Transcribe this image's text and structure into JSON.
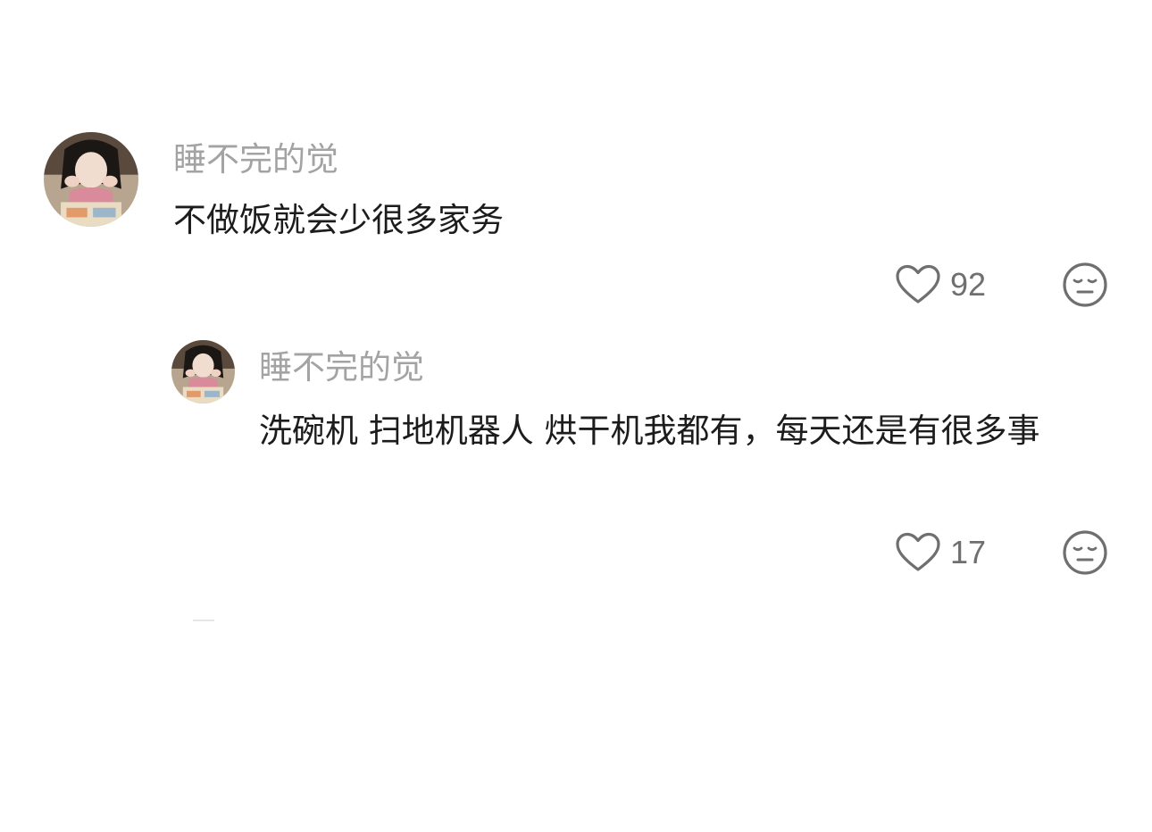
{
  "colors": {
    "username": "#a3a3a3",
    "text": "#1c1c1c",
    "icon": "#6f6f6f",
    "background": "#ffffff"
  },
  "comment": {
    "username": "睡不完的觉",
    "text": "不做饭就会少很多家务",
    "likes": "92",
    "like_icon": "heart-outline-icon",
    "reaction_icon": "expressionless-face-icon"
  },
  "reply": {
    "username": "睡不完的觉",
    "text": "洗碗机 扫地机器人 烘干机我都有，每天还是有很多事",
    "likes": "17",
    "like_icon": "heart-outline-icon",
    "reaction_icon": "expressionless-face-icon"
  }
}
